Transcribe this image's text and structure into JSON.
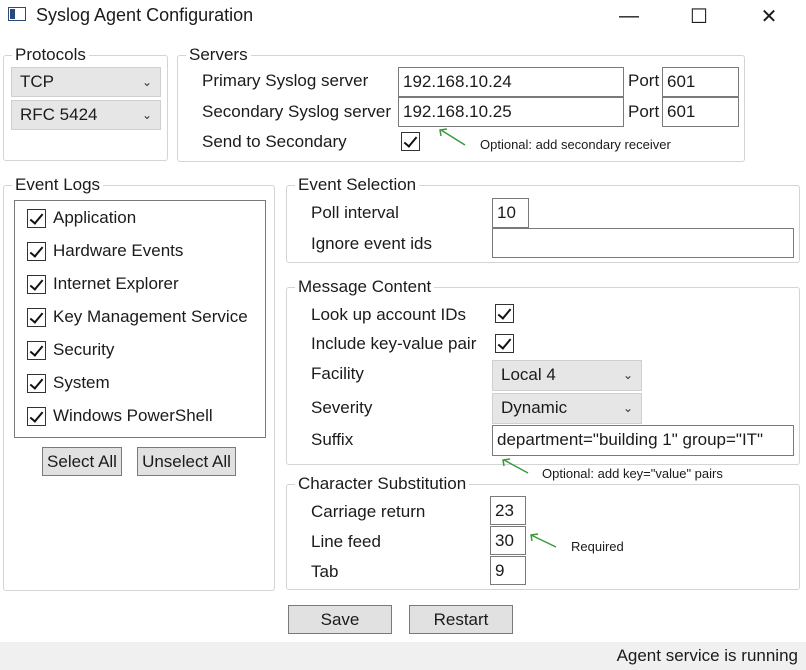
{
  "window": {
    "title": "Syslog Agent Configuration",
    "minimize": "—",
    "maximize": "☐",
    "close": "✕"
  },
  "protocols": {
    "legend": "Protocols",
    "transport": "TCP",
    "format": "RFC 5424"
  },
  "servers": {
    "legend": "Servers",
    "primary_label": "Primary Syslog server",
    "primary_value": "192.168.10.24",
    "secondary_label": "Secondary Syslog server",
    "secondary_value": "192.168.10.25",
    "port_label": "Port",
    "primary_port": "601",
    "secondary_port": "601",
    "send_secondary_label": "Send to Secondary",
    "note": "Optional: add secondary receiver"
  },
  "event_logs": {
    "legend": "Event Logs",
    "items": [
      "Application",
      "Hardware Events",
      "Internet Explorer",
      "Key Management Service",
      "Security",
      "System",
      "Windows PowerShell"
    ],
    "select_all": "Select All",
    "unselect_all": "Unselect All"
  },
  "event_selection": {
    "legend": "Event Selection",
    "poll_label": "Poll interval",
    "poll_value": "10",
    "ignore_label": "Ignore event ids",
    "ignore_value": ""
  },
  "message_content": {
    "legend": "Message Content",
    "lookup_label": "Look up account IDs",
    "kv_label": "Include key-value pair",
    "facility_label": "Facility",
    "facility_value": "Local 4",
    "severity_label": "Severity",
    "severity_value": "Dynamic",
    "suffix_label": "Suffix",
    "suffix_value": "department=\"building 1\" group=\"IT\"",
    "note": "Optional: add key=\"value\" pairs"
  },
  "char_sub": {
    "legend": "Character Substitution",
    "cr_label": "Carriage return",
    "cr_value": "23",
    "lf_label": "Line feed",
    "lf_value": "30",
    "tab_label": "Tab",
    "tab_value": "9",
    "note": "Required"
  },
  "actions": {
    "save": "Save",
    "restart": "Restart"
  },
  "status": {
    "text": "Agent service is running"
  },
  "colors": {
    "arrow": "#3a9a3a",
    "button_bg": "#e1e1e1",
    "status_bg": "#f0f0f0"
  }
}
